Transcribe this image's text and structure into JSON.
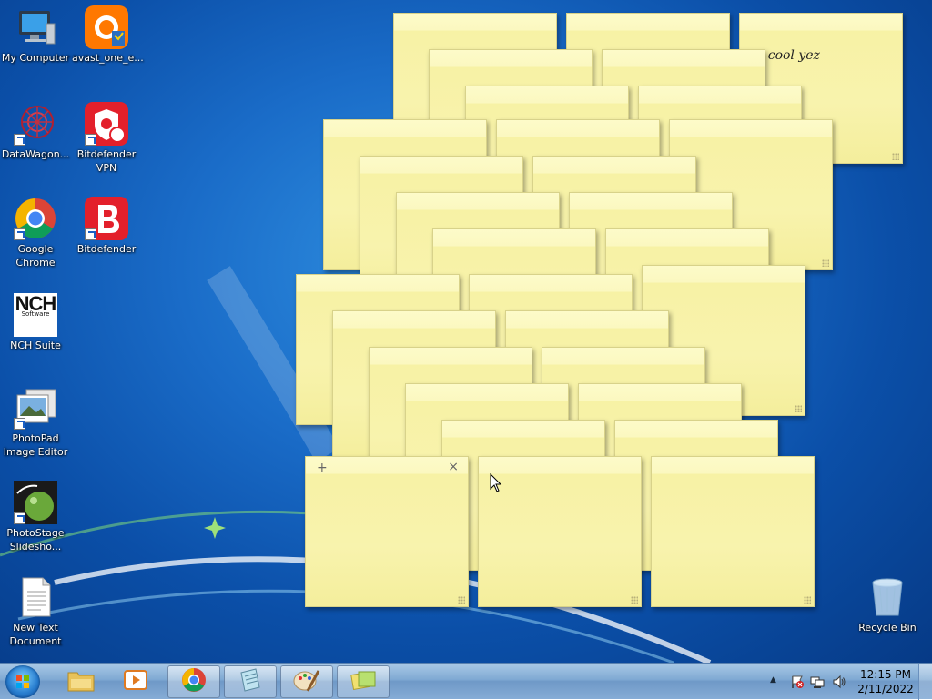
{
  "desktop": {
    "icons": [
      {
        "name": "my-computer",
        "label": "My Computer"
      },
      {
        "name": "avast",
        "label": "avast_one_e..."
      },
      {
        "name": "datawagon",
        "label": "DataWagon..."
      },
      {
        "name": "bitdefender-vpn",
        "label": "Bitdefender VPN"
      },
      {
        "name": "google-chrome",
        "label": "Google Chrome"
      },
      {
        "name": "bitdefender",
        "label": "Bitdefender"
      },
      {
        "name": "nch-suite",
        "label": "NCH Suite"
      },
      {
        "name": "photopad",
        "label": "PhotoPad Image Editor"
      },
      {
        "name": "photostage",
        "label": "PhotoStage Slidesho..."
      },
      {
        "name": "new-text-document",
        "label": "New Text Document"
      },
      {
        "name": "recycle-bin",
        "label": "Recycle Bin"
      }
    ],
    "nch_logo_text": "NCH",
    "nch_logo_sub": "Software"
  },
  "sticky_notes": {
    "count": 34,
    "visible_text": "e cool yez",
    "active_note_controls": {
      "new": "+",
      "close": "×"
    },
    "colors": {
      "paper": "#f8f3ad",
      "header": "#fdfbc9",
      "border": "#d8d28a"
    }
  },
  "taskbar": {
    "start": "start-orb",
    "pinned": [
      {
        "name": "windows-explorer",
        "icon": "folder-icon"
      },
      {
        "name": "media-player",
        "icon": "media-player-icon"
      },
      {
        "name": "chrome",
        "icon": "chrome-icon"
      },
      {
        "name": "notepad",
        "icon": "notepad-icon"
      },
      {
        "name": "paint",
        "icon": "paint-icon"
      },
      {
        "name": "sticky-notes",
        "icon": "sticky-notes-icon"
      }
    ],
    "tray_expand": "▲",
    "clock_time": "12:15 PM",
    "clock_date": "2/11/2022"
  }
}
